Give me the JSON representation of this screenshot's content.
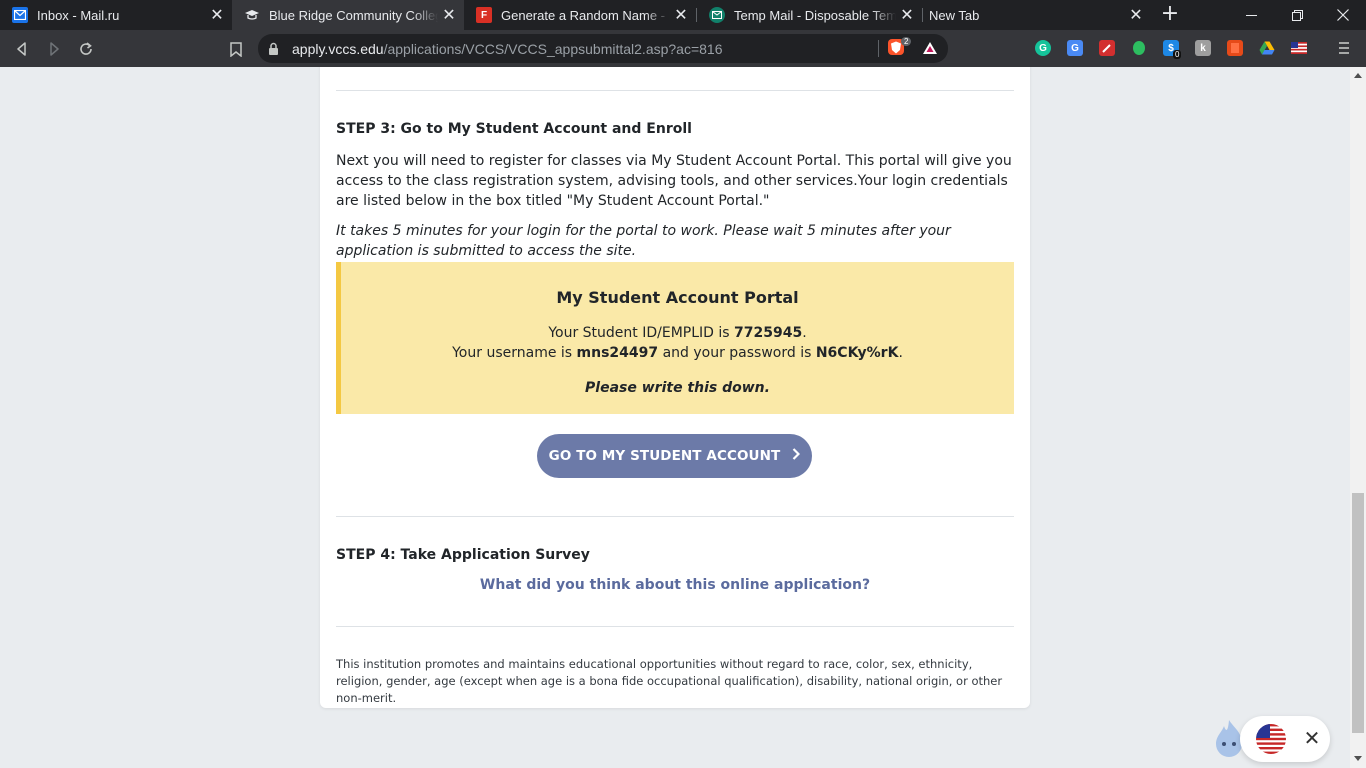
{
  "browser": {
    "tabs": [
      {
        "title": "Inbox - Mail.ru",
        "icon": "mailru-icon",
        "active": false
      },
      {
        "title": "Blue Ridge Community College -",
        "icon": "graduation-cap-icon",
        "active": true
      },
      {
        "title": "Generate a Random Name - Mal",
        "icon": "fake-name-icon",
        "active": false
      },
      {
        "title": "Temp Mail - Disposable Tempora",
        "icon": "tempmail-icon",
        "active": false
      },
      {
        "title": "New Tab",
        "icon": "",
        "active": false
      }
    ],
    "url_host": "apply.vccs.edu",
    "url_path": "/applications/VCCS/VCCS_appsubmittal2.asp?ac=816",
    "brave_badge": "2",
    "extension_badge": "0"
  },
  "page": {
    "step3_title": "STEP 3: Go to My Student Account and Enroll",
    "step3_para": "Next you will need to register for classes via My Student Account Portal. This portal will give you access to the class registration system, advising tools, and other services.Your login credentials are listed below in the box titled \"My Student Account Portal.\"",
    "step3_note": "It takes 5 minutes for your login for the portal to work. Please wait 5 minutes after your application is submitted to access the site.",
    "portal": {
      "title": "My Student Account Portal",
      "id_prefix": "Your Student ID/EMPLID is ",
      "student_id": "7725945",
      "id_suffix": ".",
      "user_prefix": "Your username is ",
      "username": "mns24497",
      "pass_prefix": " and your password is ",
      "password": "N6CKy%rK",
      "pass_suffix": ".",
      "reminder": "Please write this down."
    },
    "go_button": "GO TO MY STUDENT ACCOUNT",
    "step4_title": "STEP 4: Take Application Survey",
    "survey_link": "What did you think about this online application?",
    "footer": "This institution promotes and maintains educational opportunities without regard to race, color, sex, ethnicity, religion, gender, age (except when age is a bona fide occupational qualification), disability, national origin, or other non-merit."
  },
  "colors": {
    "portal_bg": "#fae9a8",
    "portal_border": "#f4c842",
    "button": "#6c7aa8",
    "link": "#5b6b9e"
  }
}
